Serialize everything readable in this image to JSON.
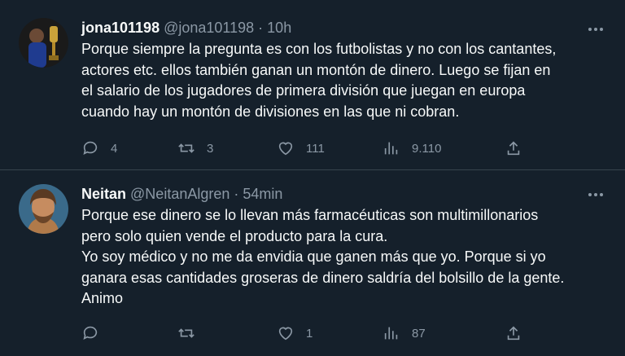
{
  "tweets": [
    {
      "name": "jona101198",
      "handle": "@jona101198",
      "sep": "·",
      "time": "10h",
      "text": "Porque siempre la pregunta es con los futbolistas y no con los cantantes,\nactores etc. ellos también ganan un montón de dinero. Luego se fijan en\nel salario de los jugadores de primera división que juegan en europa\ncuando hay un montón de divisiones en las que ni cobran.",
      "replies": "4",
      "retweets": "3",
      "likes": "111",
      "views": "9.110"
    },
    {
      "name": "Neitan",
      "handle": "@NeitanAlgren",
      "sep": "·",
      "time": "54min",
      "text": "Porque ese dinero se lo llevan más farmacéuticas son multimillonarios\npero solo quien vende el producto para la cura.\nYo soy médico y no me da envidia que ganen más que yo. Porque si yo\nganara esas cantidades groseras de dinero saldría del bolsillo de la gente.\nAnimo",
      "replies": "",
      "retweets": "",
      "likes": "1",
      "views": "87"
    }
  ],
  "icons": {
    "reply": "reply-icon",
    "retweet": "retweet-icon",
    "like": "heart-icon",
    "views": "views-icon",
    "share": "share-icon",
    "more": "more-icon"
  },
  "colors": {
    "background": "#15202b",
    "text": "#f7f9f9",
    "muted": "#8b98a5",
    "divider": "#38444d"
  }
}
